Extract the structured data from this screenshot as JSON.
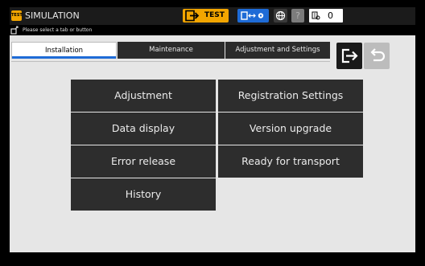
{
  "header": {
    "app_badge": "TEST",
    "title": "SIMULATION",
    "test_button_label": "TEST",
    "help_icon_label": "?",
    "counter_value": "0"
  },
  "message": {
    "text": "Please select a tab or button"
  },
  "tabs": [
    {
      "label": "Installation",
      "active": true
    },
    {
      "label": "Maintenance",
      "active": false
    },
    {
      "label": "Adjustment and Settings",
      "active": false
    }
  ],
  "menu": {
    "left": [
      "Adjustment",
      "Data display",
      "Error release",
      "History"
    ],
    "right": [
      "Registration Settings",
      "Version upgrade",
      "Ready for transport"
    ]
  },
  "colors": {
    "accent": "#f2a500",
    "active_tab_underline": "#1e6bd6",
    "menu_button": "#2d2d2d"
  }
}
